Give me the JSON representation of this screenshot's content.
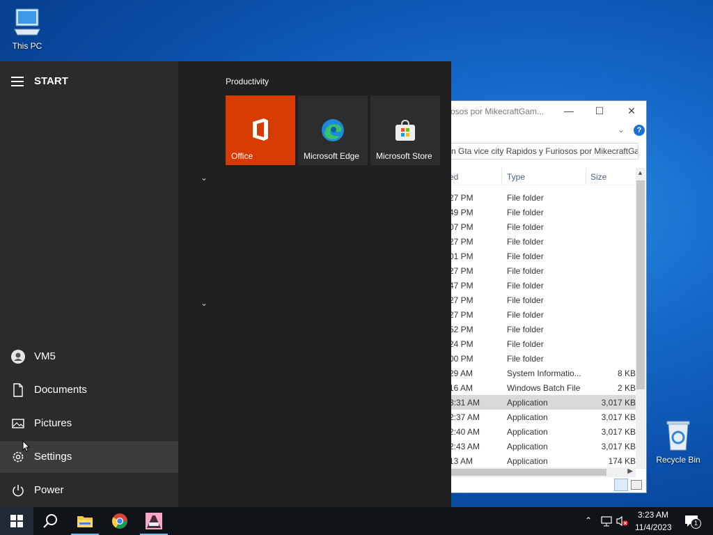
{
  "desktop": {
    "this_pc": "This PC",
    "recycle_bin": "Recycle Bin"
  },
  "explorer": {
    "title": "osos por MikecraftGam...",
    "address": "n Gta vice city Rapidos y Furiosos por MikecraftGa...",
    "columns": {
      "modified": "ed",
      "type": "Type",
      "size": "Size"
    },
    "rows": [
      {
        "time": "27 PM",
        "type": "File folder",
        "size": ""
      },
      {
        "time": "49 PM",
        "type": "File folder",
        "size": ""
      },
      {
        "time": "07 PM",
        "type": "File folder",
        "size": ""
      },
      {
        "time": "27 PM",
        "type": "File folder",
        "size": ""
      },
      {
        "time": "01 PM",
        "type": "File folder",
        "size": ""
      },
      {
        "time": "27 PM",
        "type": "File folder",
        "size": ""
      },
      {
        "time": "47 PM",
        "type": "File folder",
        "size": ""
      },
      {
        "time": "27 PM",
        "type": "File folder",
        "size": ""
      },
      {
        "time": "27 PM",
        "type": "File folder",
        "size": ""
      },
      {
        "time": "52 PM",
        "type": "File folder",
        "size": ""
      },
      {
        "time": "24 PM",
        "type": "File folder",
        "size": ""
      },
      {
        "time": "00 PM",
        "type": "File folder",
        "size": ""
      },
      {
        "time": "29 AM",
        "type": "System Informatio...",
        "size": "8 KB"
      },
      {
        "time": "16 AM",
        "type": "Windows Batch File",
        "size": "2 KB"
      },
      {
        "time": "3:31 AM",
        "type": "Application",
        "size": "3,017 KB"
      },
      {
        "time": "2:37 AM",
        "type": "Application",
        "size": "3,017 KB"
      },
      {
        "time": "2:40 AM",
        "type": "Application",
        "size": "3,017 KB"
      },
      {
        "time": "2:43 AM",
        "type": "Application",
        "size": "3,017 KB"
      },
      {
        "time": "13 AM",
        "type": "Application",
        "size": "174 KB"
      }
    ],
    "selected_row": 14
  },
  "start": {
    "header": "START",
    "group_title": "Productivity",
    "tiles": [
      {
        "label": "Office",
        "color": "#d83b01"
      },
      {
        "label": "Microsoft Edge",
        "color": "#2d2d2d"
      },
      {
        "label": "Microsoft Store",
        "color": "#2d2d2d"
      }
    ],
    "nav": {
      "user": "VM5",
      "documents": "Documents",
      "pictures": "Pictures",
      "settings": "Settings",
      "power": "Power"
    }
  },
  "taskbar": {
    "time": "3:23 AM",
    "date": "11/4/2023",
    "notification_count": "1",
    "accent": "#76b9ed"
  }
}
